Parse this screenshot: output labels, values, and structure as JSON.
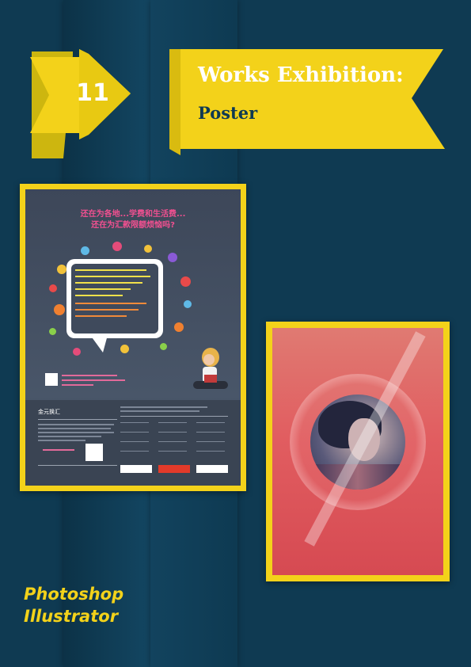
{
  "header": {
    "section_number": "11",
    "title": "Works Exhibition:",
    "subtitle": "Poster"
  },
  "colors": {
    "background": "#0f3a52",
    "accent_yellow": "#f3d21a",
    "title_text": "#ffffff",
    "subtitle_text": "#0f3a52"
  },
  "posters": [
    {
      "id": "finance-poster",
      "headline_line1": "还在为各地...学费和生活费...",
      "headline_line2": "还在为汇款限额烦恼吗?",
      "bottom_title": "金元换汇"
    },
    {
      "id": "portrait-poster"
    }
  ],
  "software": [
    "Photoshop",
    "Illustrator"
  ]
}
